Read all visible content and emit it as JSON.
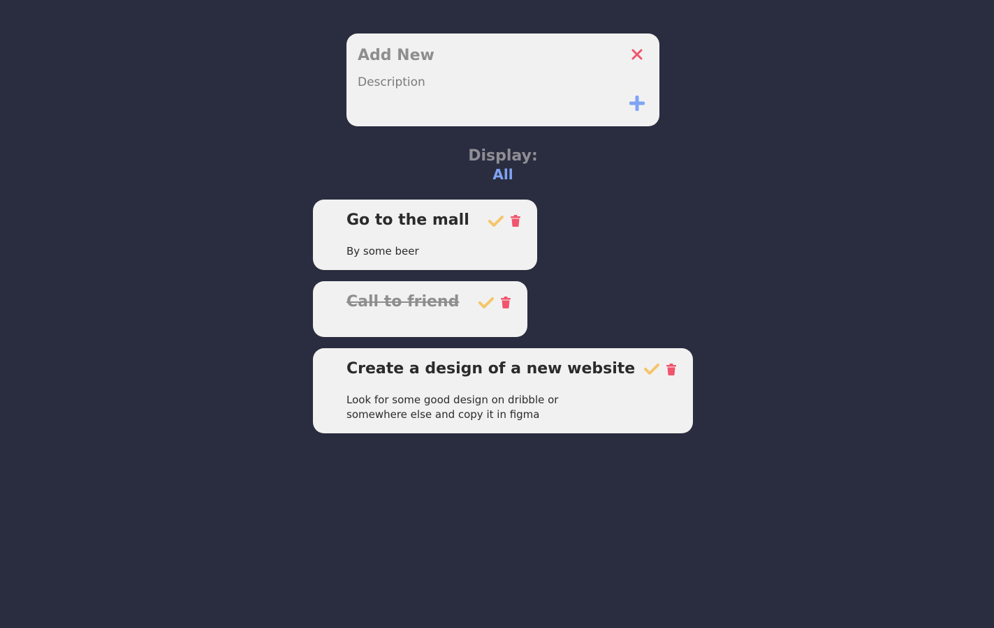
{
  "add_form": {
    "title_placeholder": "Add New",
    "description_placeholder": "Description",
    "close_icon": "close-icon",
    "add_icon": "plus-icon"
  },
  "filter": {
    "label": "Display:",
    "value": "All"
  },
  "todos": [
    {
      "title": "Go to the mall",
      "description": "By some beer",
      "completed": false
    },
    {
      "title": "Call to friend",
      "description": "",
      "completed": true
    },
    {
      "title": "Create a design of a new website",
      "description": "Look for some good design on dribble or somewhere else and copy it in figma",
      "completed": false
    }
  ],
  "colors": {
    "background": "#2a2d3f",
    "card": "#f1f1f1",
    "check": "#f5c56b",
    "delete": "#f0556d",
    "accent": "#7fa4f5",
    "close": "#f0556d"
  }
}
